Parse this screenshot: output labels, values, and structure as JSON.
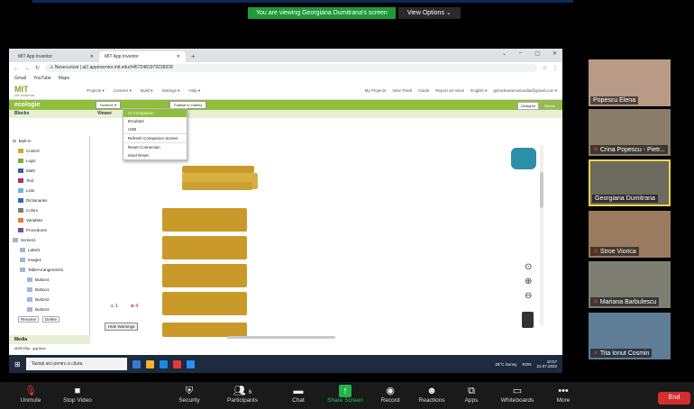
{
  "banner": {
    "viewing": "You are viewing Georgiana Dumitrana's screen",
    "options": "View Options ⌄"
  },
  "browser": {
    "tabs": [
      "MIT App Inventor",
      "MIT App Inventor"
    ],
    "address_prefix": "Nesecurizat",
    "address": "ai2.appinventor.mit.edu/#4572481979236928",
    "bookmarks": [
      "Gmail",
      "YouTube",
      "Maps"
    ]
  },
  "ai": {
    "logo": "MIT",
    "logo_sub": "APP INVENTOR",
    "menu": [
      "Projects ▾",
      "Connect ▾",
      "Build ▾",
      "Settings ▾",
      "Help ▾"
    ],
    "right_menu": [
      "My Projects",
      "View Trash",
      "Guide",
      "Report an Issue",
      "English ▾",
      "gebodnaramusiuodia@gmail.com ▾"
    ],
    "project": "ecologie",
    "screen_btn": "Screen1 ▾",
    "publish_btn": "Publish to Gallery",
    "designer": "Designer",
    "blocks": "Blocks",
    "connect_menu": [
      "AI Companion",
      "Emulator",
      "USB",
      "Refresh Companion Screen",
      "Reset Connection",
      "Hard Reset"
    ],
    "blocks_title": "Blocks",
    "viewer_title": "Viewer",
    "builtin": "Built-in",
    "builtin_items": [
      {
        "label": "Control",
        "color": "#d6a72b"
      },
      {
        "label": "Logic",
        "color": "#7fab3a"
      },
      {
        "label": "Math",
        "color": "#3262b5"
      },
      {
        "label": "Text",
        "color": "#b32d5e"
      },
      {
        "label": "Lists",
        "color": "#73aff3"
      },
      {
        "label": "Dictionaries",
        "color": "#2d6fb5"
      },
      {
        "label": "Colors",
        "color": "#7d7d7d"
      },
      {
        "label": "Variables",
        "color": "#ec7a32"
      },
      {
        "label": "Procedures",
        "color": "#7b4bb0"
      }
    ],
    "screen_items": [
      "Screen1",
      "Label1",
      "Image1",
      "TableArrangement1",
      "Button4",
      "Button1",
      "Button2",
      "Button3"
    ],
    "rename": "Rename",
    "delete": "Delete",
    "media": "Media",
    "media_item": "M2RCRjn...jpg time",
    "warn_count": "1",
    "err_count": "4",
    "hide_warnings": "Hide Warnings"
  },
  "taskbar": {
    "search": "Tastați aici pentru a căuta",
    "weather": "26°C Sunny",
    "lang": "RON",
    "time": "10:57",
    "date": "21.07.2022"
  },
  "participants": [
    "Popescu Elena",
    "Crina Popescu - Pietr...",
    "Georgiana Dumitrana",
    "Stroe Viorica",
    "Mariana Barbulescu",
    "Tita Ionut Cosmin"
  ],
  "toolbar": {
    "unmute": "Unmute",
    "stop_video": "Stop Video",
    "security": "Security",
    "participants": "Participants",
    "participants_count": "6",
    "chat": "Chat",
    "share": "Share Screen",
    "record": "Record",
    "reactions": "Reactions",
    "apps": "Apps",
    "whiteboards": "Whiteboards",
    "more": "More",
    "end": "End"
  }
}
